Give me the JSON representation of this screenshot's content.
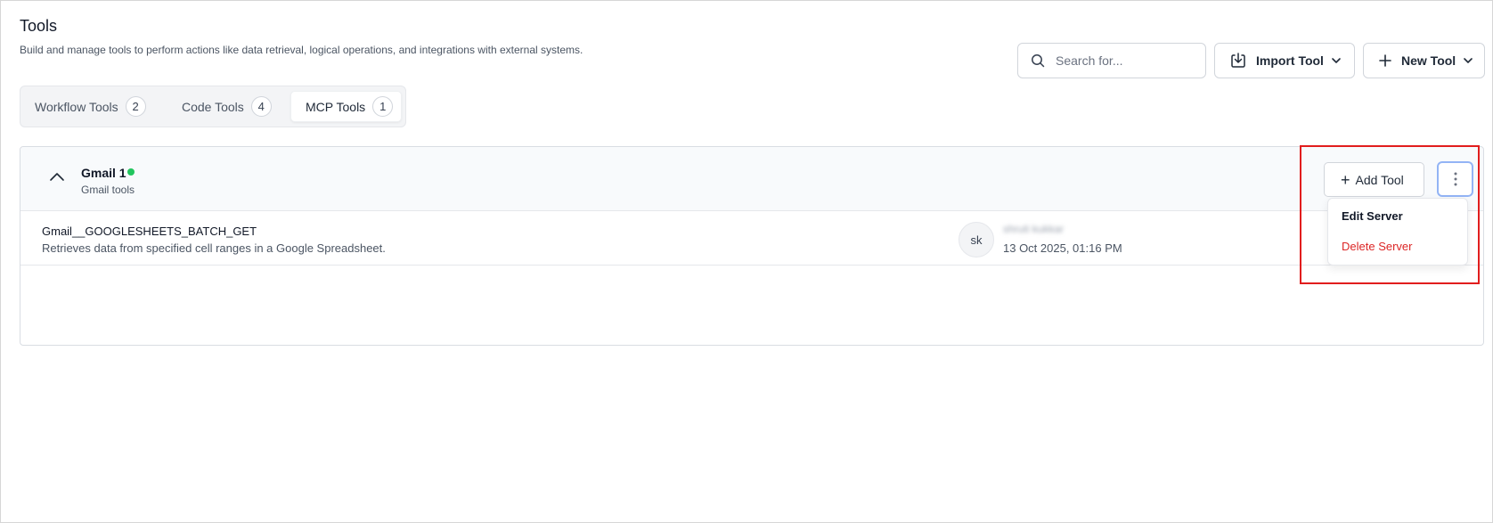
{
  "page": {
    "title": "Tools",
    "subtitle": "Build and manage tools to perform actions like data retrieval, logical operations, and integrations with external systems."
  },
  "toolbar": {
    "search_placeholder": "Search for...",
    "import_label": "Import Tool",
    "new_label": "New Tool"
  },
  "tabs": [
    {
      "label": "Workflow Tools",
      "count": "2",
      "active": false
    },
    {
      "label": "Code Tools",
      "count": "4",
      "active": false
    },
    {
      "label": "MCP Tools",
      "count": "1",
      "active": true
    }
  ],
  "server": {
    "name": "Gmail 1",
    "description": "Gmail tools",
    "status": "online",
    "status_color": "#22c55e",
    "add_tool_label": "Add Tool"
  },
  "tools": [
    {
      "name": "Gmail__GOOGLESHEETS_BATCH_GET",
      "description": "Retrieves data from specified cell ranges in a Google Spreadsheet.",
      "avatar_initials": "sk",
      "author": "shruti kukkar",
      "updated": "13 Oct 2025, 01:16 PM"
    }
  ],
  "menu": {
    "edit_label": "Edit Server",
    "delete_label": "Delete Server",
    "delete_color": "#dc2626"
  },
  "highlight_color": "#e11d1d",
  "icons": {
    "search": "search-icon",
    "import": "download-tray-icon",
    "new": "plus-icon",
    "chevron": "chevron-down-icon",
    "collapse": "chevron-up-icon",
    "more": "kebab-menu-icon"
  }
}
